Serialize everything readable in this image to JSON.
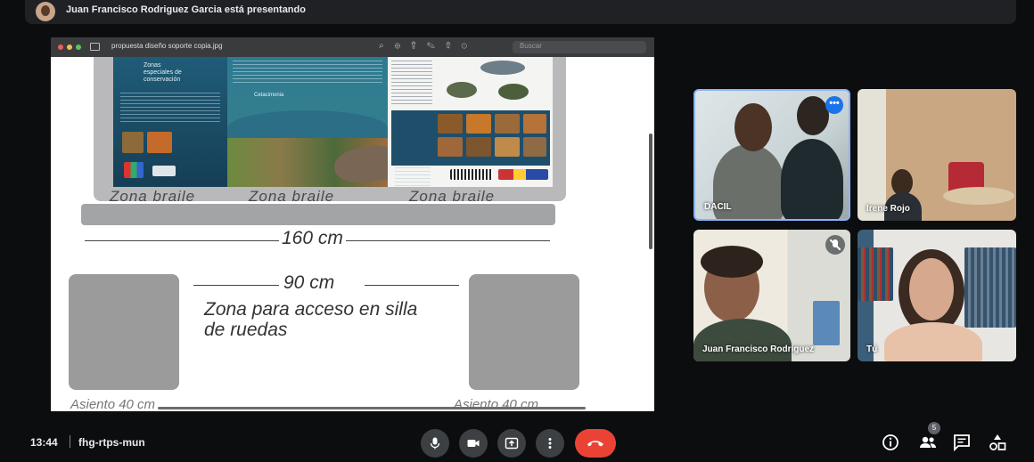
{
  "banner": {
    "text": "Juan Francisco Rodriguez Garcia está presentando"
  },
  "presentation": {
    "file_name": "propuesta diseño soporte copia.jpg",
    "viewer_search_placeholder": "Buscar",
    "sign_panel_left_title": "Zonas\nespeciales de\nconservación",
    "sign_panel_center_caption": "Cetacimonia",
    "braile_labels": [
      "Zona braile",
      "Zona braile",
      "Zona braile"
    ],
    "width_total": "160 cm",
    "width_access": "90 cm",
    "access_zone": "Zona para acceso en silla\nde ruedas",
    "seat_labels": [
      "Asiento 40 cm",
      "Asiento 40 cm"
    ]
  },
  "participants": [
    {
      "name": "DACIL",
      "active_speaker": true
    },
    {
      "name": "Irene Rojo"
    },
    {
      "name": "Juan Francisco Rodriguez",
      "muted": true
    },
    {
      "name": "Tú"
    }
  ],
  "bottom_bar": {
    "time": "13:44",
    "meeting_code": "fhg-rtps-mun",
    "participant_count": "5"
  },
  "colors": {
    "end_call": "#ea4335",
    "active_border": "#8ab4f8",
    "control_bg": "#3c4043"
  }
}
